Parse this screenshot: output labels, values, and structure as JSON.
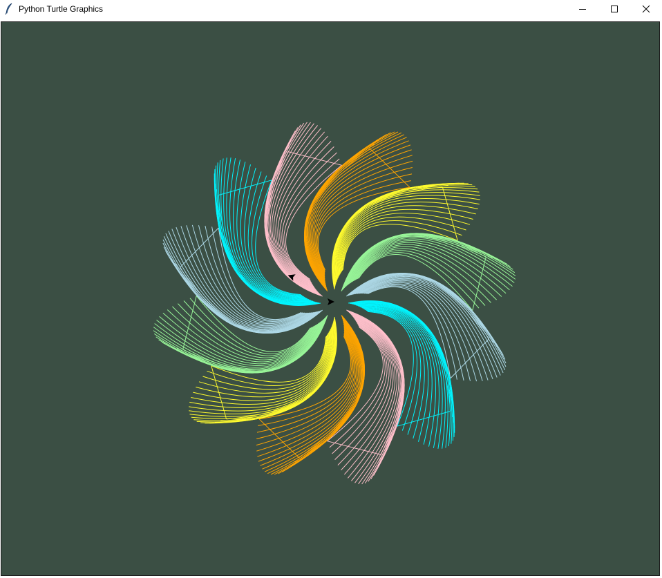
{
  "window": {
    "title": "Python Turtle Graphics",
    "icon": "feather-icon",
    "controls": {
      "minimize": "minimize-icon",
      "maximize": "maximize-icon",
      "close": "close-icon"
    }
  },
  "canvas": {
    "background": "#3b4f44",
    "frame_color": "#1c1c1c",
    "pattern": {
      "petal_colors": [
        "#fffb2e",
        "#98f598",
        "#add8e6",
        "#00f5ff",
        "#ffc0cb",
        "#ffa500",
        "#fffb2e",
        "#98f598",
        "#add8e6",
        "#00f5ff",
        "#ffc0cb",
        "#ffa500"
      ],
      "petal_count": 12,
      "arcs_per_petal": 20,
      "turtle_color": "#000000"
    }
  }
}
